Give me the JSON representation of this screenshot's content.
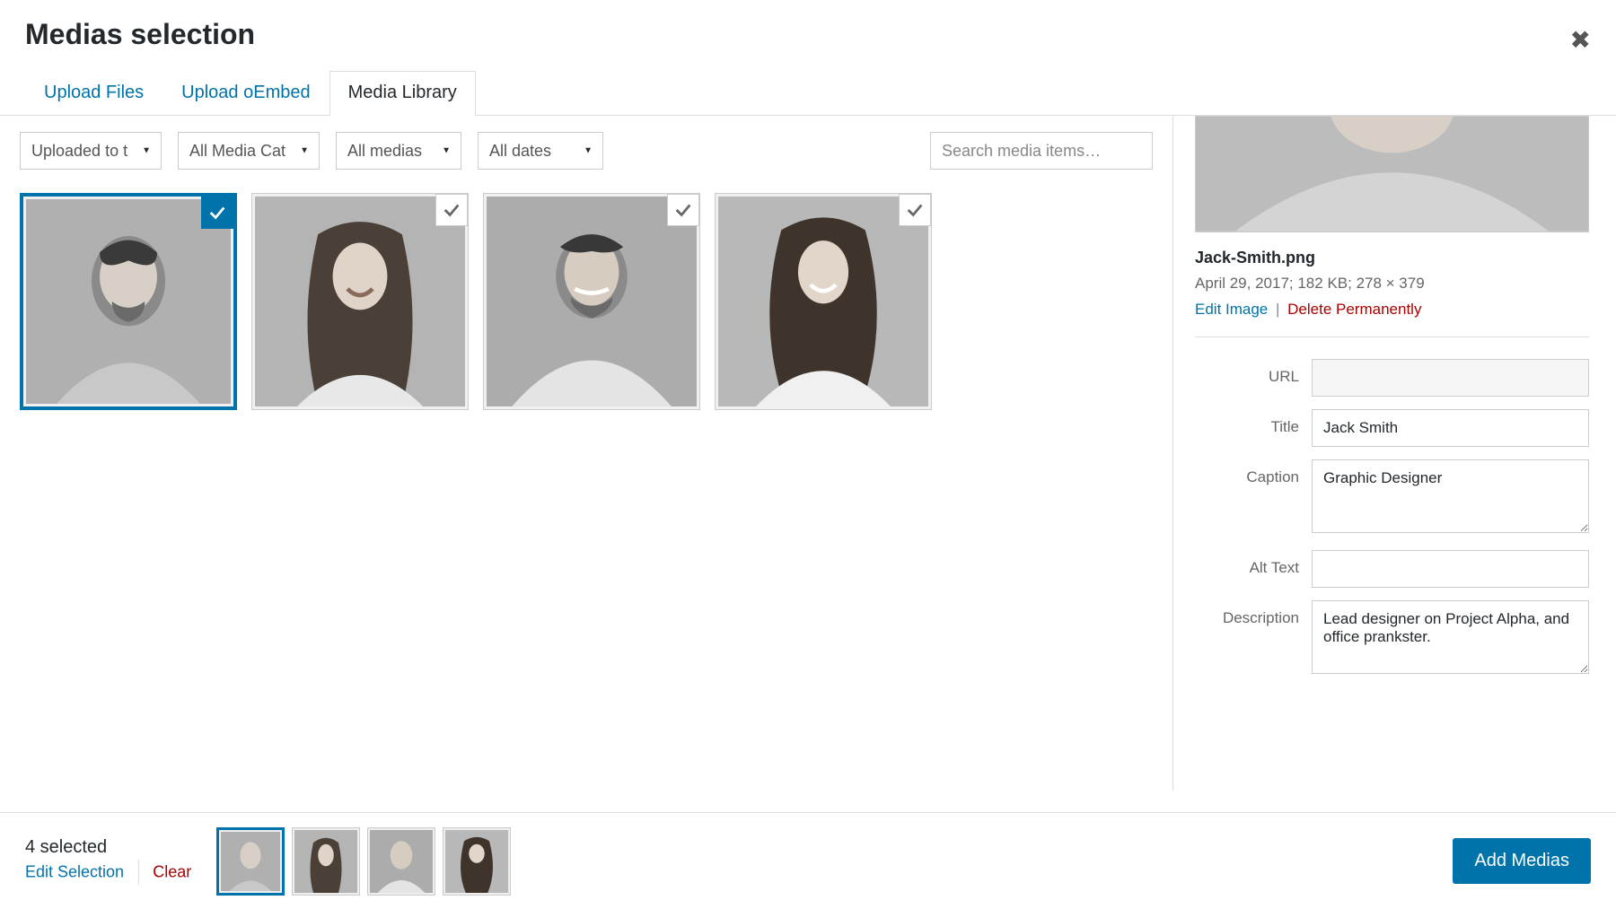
{
  "header": {
    "title": "Medias selection"
  },
  "tabs": [
    {
      "label": "Upload Files",
      "active": false
    },
    {
      "label": "Upload oEmbed",
      "active": false
    },
    {
      "label": "Media Library",
      "active": true
    }
  ],
  "filters": {
    "attachment": "Uploaded to t",
    "category": "All Media Cat",
    "type": "All medias",
    "date": "All dates"
  },
  "search": {
    "placeholder": "Search media items…"
  },
  "details": {
    "filename": "Jack-Smith.png",
    "meta": "April 29, 2017;  182 KB;  278 × 379",
    "edit_label": "Edit Image",
    "delete_label": "Delete Permanently",
    "fields": {
      "url_label": "URL",
      "url_value": "",
      "title_label": "Title",
      "title_value": "Jack Smith",
      "caption_label": "Caption",
      "caption_value": "Graphic Designer",
      "alt_label": "Alt Text",
      "alt_value": "",
      "desc_label": "Description",
      "desc_value": "Lead designer on Project Alpha, and office prankster."
    }
  },
  "footer": {
    "count_text": "4 selected",
    "edit_label": "Edit Selection",
    "clear_label": "Clear",
    "add_button": "Add Medias"
  }
}
